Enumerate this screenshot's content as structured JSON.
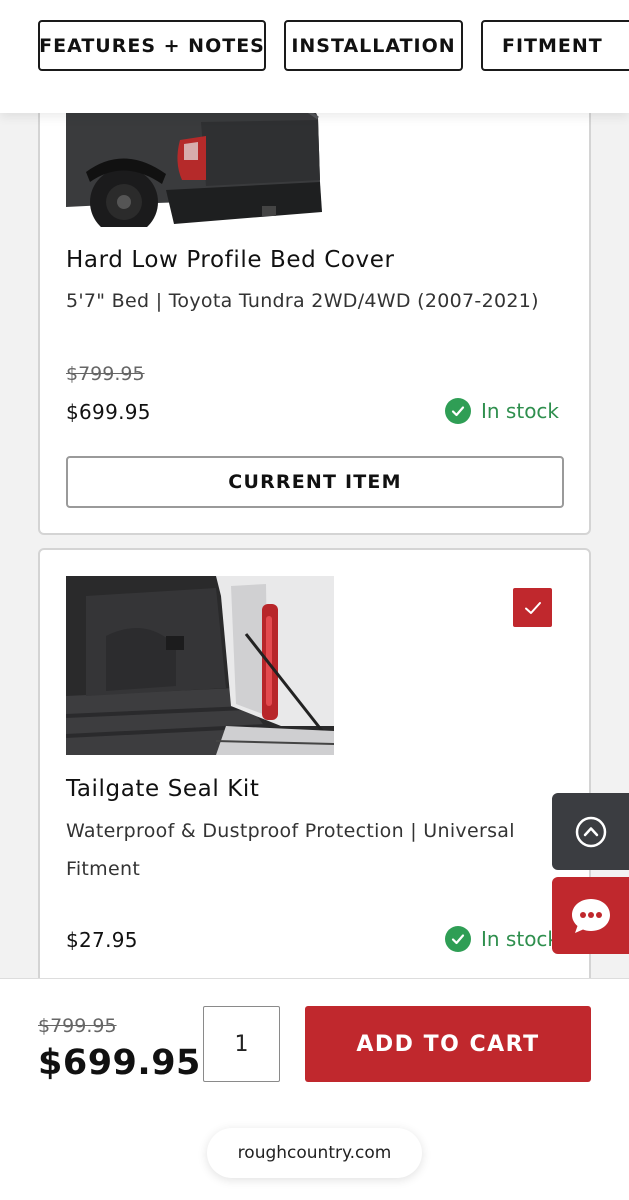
{
  "tabs": [
    {
      "label": "FEATURES + NOTES"
    },
    {
      "label": "INSTALLATION"
    },
    {
      "label": "FITMENT"
    }
  ],
  "products": [
    {
      "title": "Hard Low Profile Bed Cover",
      "subtitle": "5'7\" Bed | Toyota Tundra 2WD/4WD (2007-2021)",
      "old_price": "$799.95",
      "price": "$699.95",
      "stock": "In stock",
      "button_label": "CURRENT ITEM"
    },
    {
      "title": "Tailgate Seal Kit",
      "subtitle": "Waterproof & Dustproof Protection | Universal Fitment",
      "price": "$27.95",
      "stock": "In stock",
      "selected": true
    }
  ],
  "bottom_bar": {
    "old_price": "$799.95",
    "price": "$699.95",
    "quantity": "1",
    "add_to_cart_label": "ADD TO CART"
  },
  "url": "roughcountry.com",
  "colors": {
    "accent_red": "#c0282d",
    "stock_green": "#2f9e55",
    "dark_button": "#3b3d41"
  },
  "icons": [
    "checkmark-icon",
    "chevron-up-icon",
    "chat-bubble-icon"
  ]
}
